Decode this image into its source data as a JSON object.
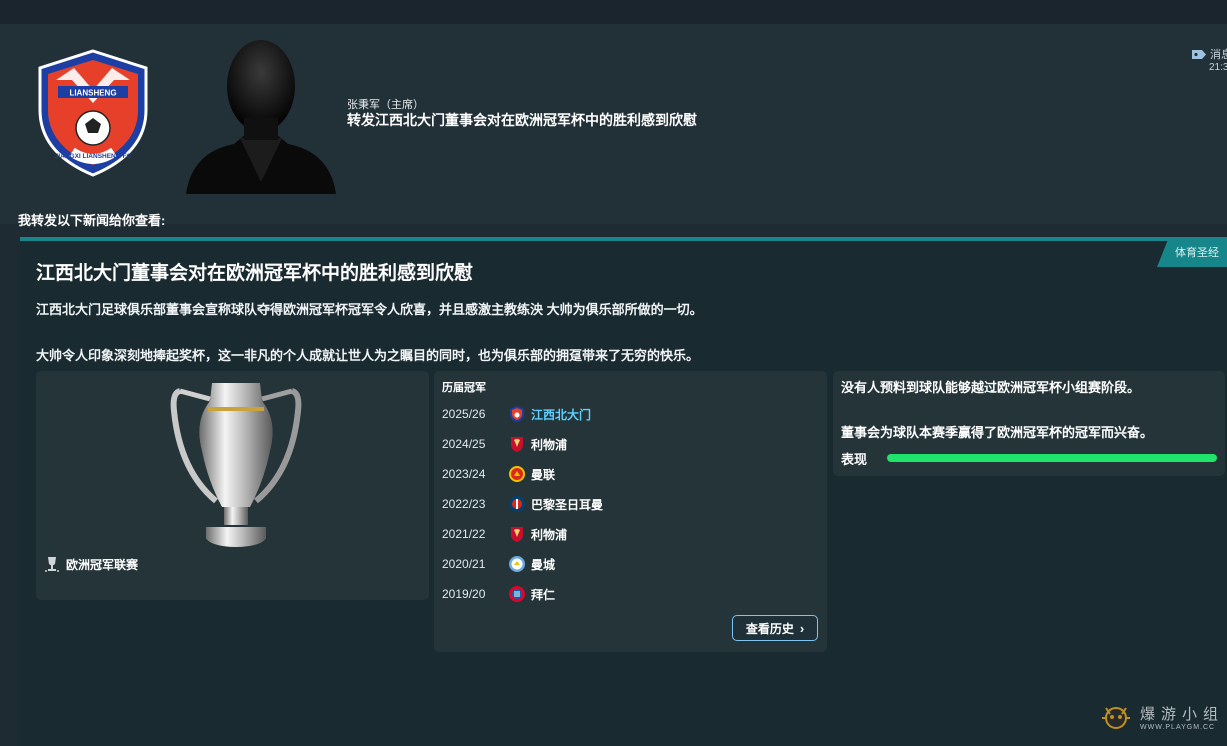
{
  "header": {
    "club_badge": {
      "icon": "jiangxi-liansheng-crest-icon",
      "top_text": "LIANSHENG",
      "ring_text": "JIANGXI LIANSHENG FC"
    },
    "sender": "张秉军（主席）",
    "subject": "转发江西北大门董事会对在欧洲冠军杯中的胜利感到欣慰",
    "message_tag": "消息",
    "message_time": "21:3"
  },
  "forward_line": "我转发以下新闻给你查看:",
  "article": {
    "source_tag": "体育圣经",
    "headline": "江西北大门董事会对在欧洲冠军杯中的胜利感到欣慰",
    "paragraph1": "江西北大门足球俱乐部董事会宣称球队夺得欧洲冠军杯冠军令人欣喜，并且感激主教练泱 大帅为俱乐部所做的一切。",
    "paragraph2": "大帅令人印象深刻地捧起奖杯，这一非凡的个人成就让世人为之瞩目的同时，也为俱乐部的拥趸带来了无穷的快乐。"
  },
  "trophy": {
    "competition_name": "欧洲冠军联赛",
    "icon": "trophy-icon"
  },
  "past_winners": {
    "title": "历届冠军",
    "rows": [
      {
        "season": "2025/26",
        "club": "江西北大门",
        "crest": "jiangxi-crest-icon",
        "highlight": true
      },
      {
        "season": "2024/25",
        "club": "利物浦",
        "crest": "liverpool-crest-icon",
        "highlight": false
      },
      {
        "season": "2023/24",
        "club": "曼联",
        "crest": "man-utd-crest-icon",
        "highlight": false
      },
      {
        "season": "2022/23",
        "club": "巴黎圣日耳曼",
        "crest": "psg-crest-icon",
        "highlight": false
      },
      {
        "season": "2021/22",
        "club": "利物浦",
        "crest": "liverpool-crest-icon",
        "highlight": false
      },
      {
        "season": "2020/21",
        "club": "曼城",
        "crest": "man-city-crest-icon",
        "highlight": false
      },
      {
        "season": "2019/20",
        "club": "拜仁",
        "crest": "bayern-crest-icon",
        "highlight": false
      }
    ],
    "history_button": "查看历史"
  },
  "board": {
    "text1": "没有人预料到球队能够越过欧洲冠军杯小组赛阶段。",
    "text2": "董事会为球队本赛季赢得了欧洲冠军杯的冠军而兴奋。",
    "performance_label": "表现",
    "performance_value": 1.0,
    "performance_color": "#1fe36a"
  },
  "watermark": {
    "text": "爆游小组",
    "url": "WWW.PLAYGM.CC"
  },
  "colors": {
    "accent": "#17868a",
    "highlight_link": "#5fd0ff"
  }
}
